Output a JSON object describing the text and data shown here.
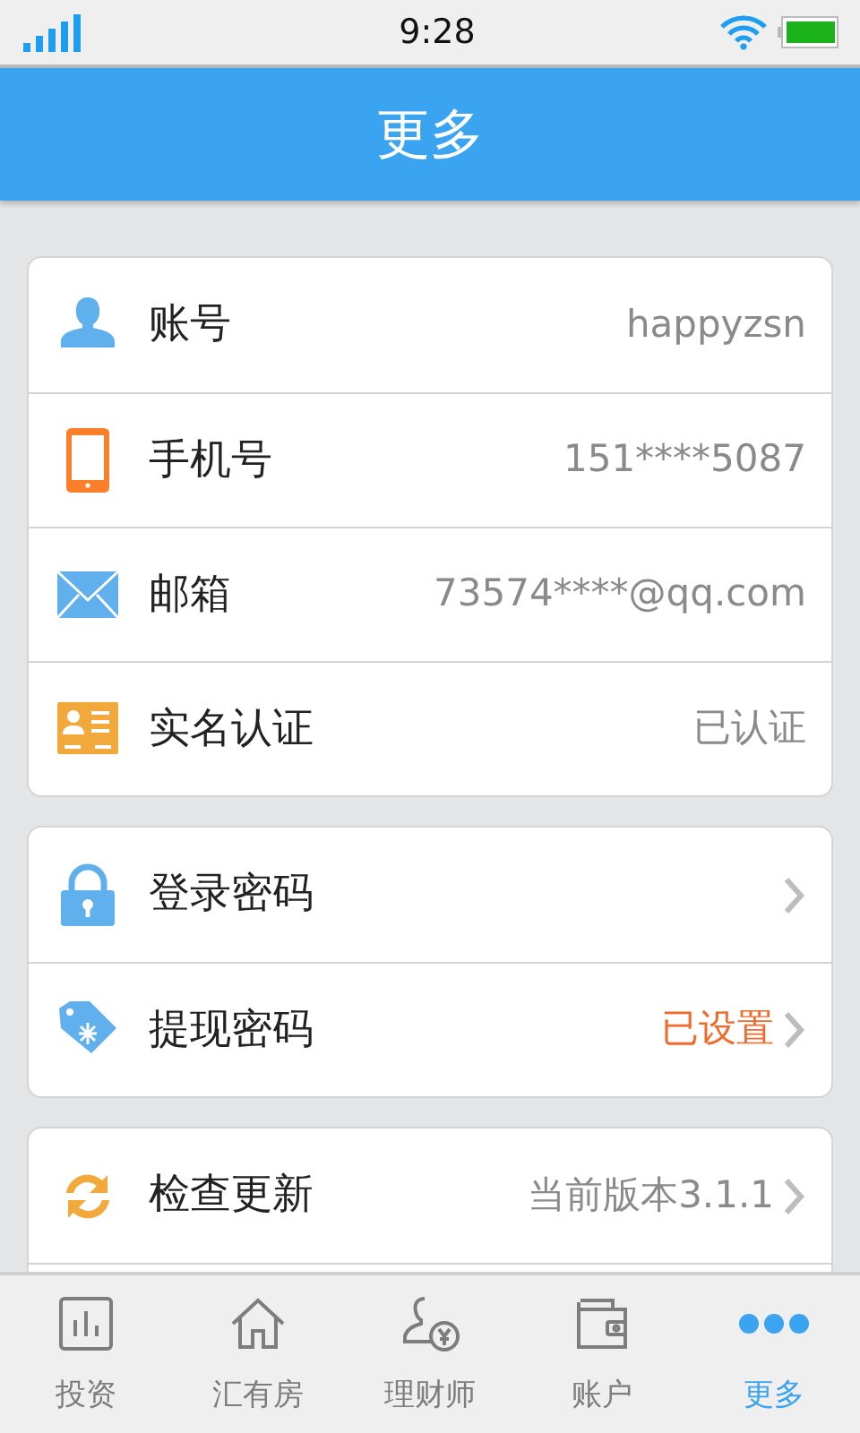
{
  "status_bar": {
    "time": "9:28"
  },
  "header": {
    "title": "更多"
  },
  "groups": [
    {
      "rows": [
        {
          "kind": "person",
          "label": "账号",
          "value": "happyzsn",
          "chevron": false,
          "highlight": false
        },
        {
          "kind": "phone",
          "label": "手机号",
          "value": "151****5087",
          "chevron": false,
          "highlight": false
        },
        {
          "kind": "mail",
          "label": "邮箱",
          "value": "73574****@qq.com",
          "chevron": false,
          "highlight": false
        },
        {
          "kind": "id-card",
          "label": "实名认证",
          "value": "已认证",
          "chevron": false,
          "highlight": false
        }
      ]
    },
    {
      "rows": [
        {
          "kind": "lock",
          "label": "登录密码",
          "chevron": true
        },
        {
          "kind": "tag",
          "label": "提现密码",
          "value": "已设置",
          "chevron": true,
          "highlight": true
        }
      ]
    },
    {
      "rows": [
        {
          "kind": "refresh",
          "label": "检查更新",
          "value": "当前版本3.1.1",
          "chevron": true,
          "highlight": false
        },
        {
          "kind": "blank"
        }
      ]
    }
  ],
  "tab_bar": [
    {
      "kind": "chart",
      "label": "投资",
      "selected": false
    },
    {
      "kind": "house",
      "label": "汇有房",
      "selected": false
    },
    {
      "kind": "advisor",
      "label": "理财师",
      "selected": false
    },
    {
      "kind": "wallet",
      "label": "账户",
      "selected": false
    },
    {
      "kind": "dots",
      "label": "更多",
      "selected": true
    }
  ]
}
